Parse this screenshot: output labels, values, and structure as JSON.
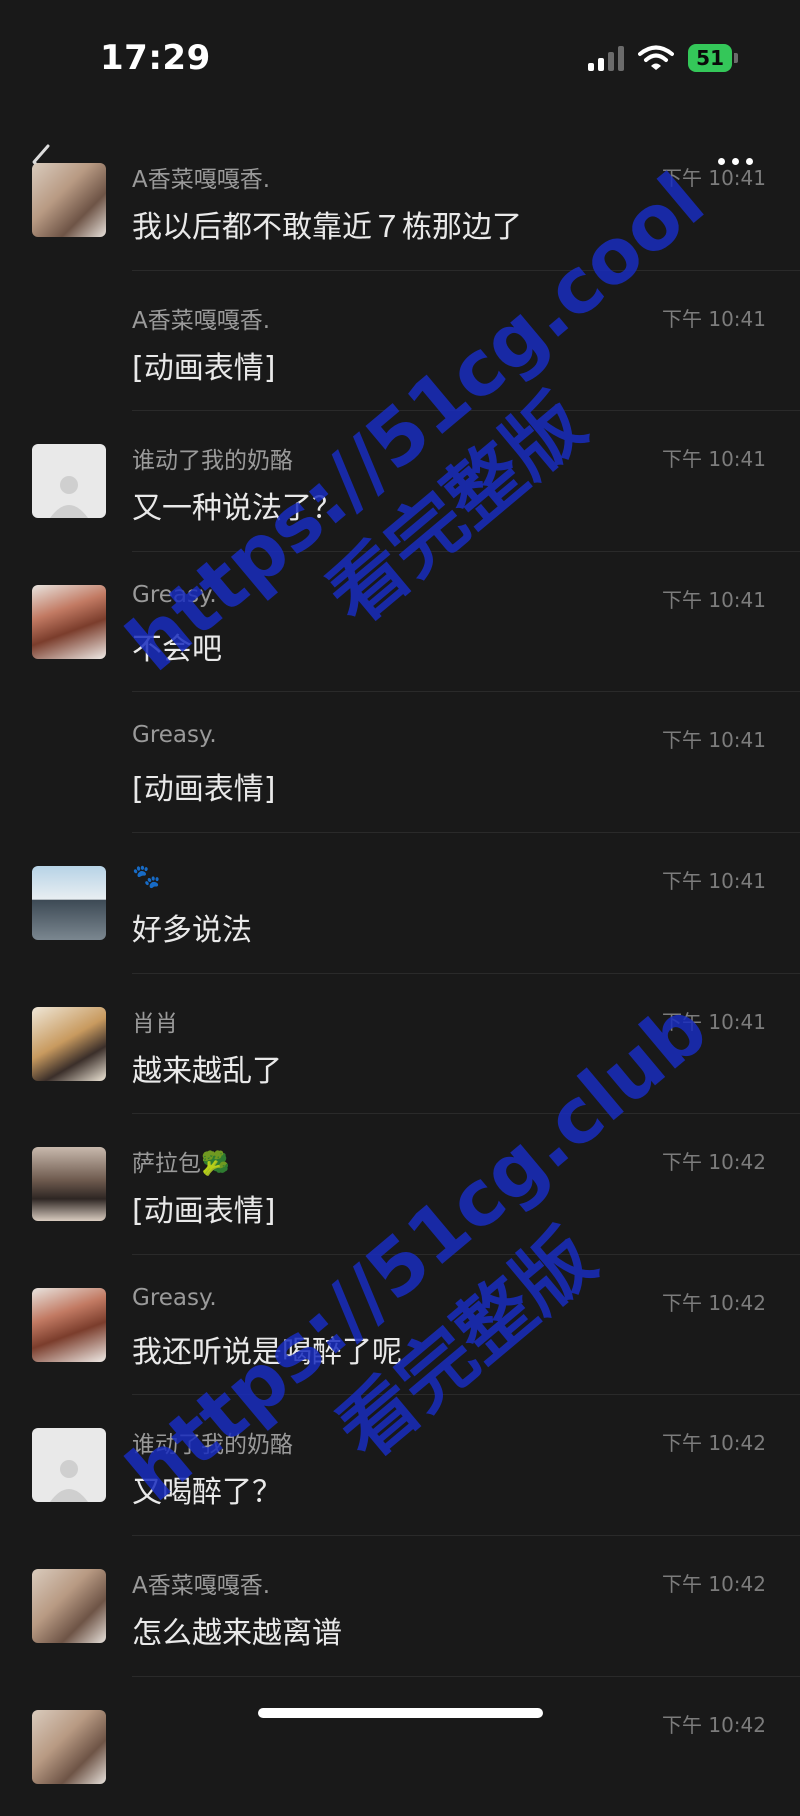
{
  "status_bar": {
    "time": "17:29",
    "battery": "51"
  },
  "messages": [
    {
      "sender": "A香菜嘎嘎香.",
      "time": "下午 10:41",
      "text": "我以后都不敢靠近７栋那边了",
      "avatar": "portrait"
    },
    {
      "sender": "A香菜嘎嘎香.",
      "time": "下午 10:41",
      "text": "[动画表情]",
      "avatar": "none"
    },
    {
      "sender": "谁动了我的奶酪",
      "time": "下午 10:41",
      "text": "又一种说法了？",
      "avatar": "default"
    },
    {
      "sender": "Greasy.",
      "time": "下午 10:41",
      "text": "不会吧",
      "avatar": "red"
    },
    {
      "sender": "Greasy.",
      "time": "下午 10:41",
      "text": "[动画表情]",
      "avatar": "none"
    },
    {
      "sender": "🐾",
      "time": "下午 10:41",
      "text": "好多说法",
      "avatar": "penguin"
    },
    {
      "sender": "肖肖",
      "time": "下午 10:41",
      "text": "越来越乱了",
      "avatar": "cat"
    },
    {
      "sender": "萨拉包🥦",
      "time": "下午 10:42",
      "text": "[动画表情]",
      "avatar": "doll"
    },
    {
      "sender": "Greasy.",
      "time": "下午 10:42",
      "text": "我还听说是喝醉了呢",
      "avatar": "red"
    },
    {
      "sender": "谁动了我的奶酪",
      "time": "下午 10:42",
      "text": "又喝醉了？",
      "avatar": "default"
    },
    {
      "sender": "A香菜嘎嘎香.",
      "time": "下午 10:42",
      "text": "怎么越来越离谱",
      "avatar": "portrait"
    },
    {
      "sender": "",
      "time": "下午 10:42",
      "text": "",
      "avatar": "portrait"
    }
  ],
  "watermarks": {
    "url_1": "https://51cg.cool",
    "text_1": "看完整版",
    "url_2": "https://51cg.club",
    "text_2": "看完整版"
  },
  "icons": {
    "back": "chevron-left-icon",
    "more": "more-dots-icon",
    "signal": "cellular-signal-icon",
    "wifi": "wifi-icon",
    "battery": "battery-icon"
  },
  "colors": {
    "background": "#191919",
    "battery_green": "#34c759",
    "watermark_blue": "#192dbe"
  }
}
